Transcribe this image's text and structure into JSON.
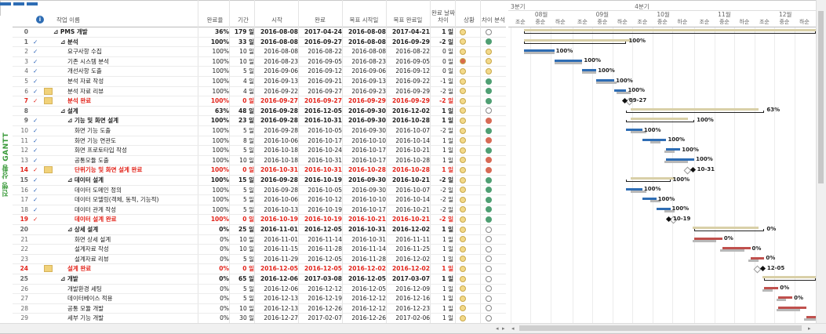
{
  "view_label": "진행 상황 GANTT",
  "columns": {
    "name": "작업 이름",
    "percent": "완료율",
    "duration": "기간",
    "start": "시작",
    "finish": "완료",
    "baseline_start": "목표 시작일",
    "baseline_finish": "목표 완료일",
    "variance": "완료 날짜 차이",
    "smile": "상황",
    "diff": "차이 분석"
  },
  "timescale": {
    "quarters": [
      "3분기",
      "4분기"
    ],
    "months": [
      "08월",
      "09월",
      "10월",
      "11월",
      "12월"
    ],
    "thirds": [
      "조순",
      "중순",
      "하순"
    ]
  },
  "colors": {
    "smile_yellow": "#f3d98a",
    "smile_red": "#d96b4c",
    "diff_green": "#4f9f73",
    "diff_red": "#d86a55",
    "bar_blue": "#2e6db4",
    "bar_red": "#c0504d",
    "baseline": "#b8b8b8",
    "summary_baseline": "#d9d0a8"
  },
  "tasks": [
    {
      "id": "0",
      "check": false,
      "note": false,
      "indent": 0,
      "name": "⊿ PMS 개발",
      "pct": "36%",
      "dur": "179 일",
      "start": "2016-08-08",
      "finish": "2017-04-24",
      "bstart": "2016-08-08",
      "bfinish": "2017-04-21",
      "var": "1 일",
      "smile": "yellow",
      "diff": "open",
      "type": "sum"
    },
    {
      "id": "1",
      "check": true,
      "note": false,
      "indent": 1,
      "name": "⊿ 분석",
      "pct": "100%",
      "dur": "33 일",
      "start": "2016-08-08",
      "finish": "2016-09-27",
      "bstart": "2016-08-08",
      "bfinish": "2016-09-29",
      "var": "-2 일",
      "smile": "yellow",
      "diff": "green",
      "type": "sum"
    },
    {
      "id": "2",
      "check": true,
      "note": false,
      "indent": 2,
      "name": "요구사항 수집",
      "pct": "100%",
      "dur": "10 일",
      "start": "2016-08-08",
      "finish": "2016-08-22",
      "bstart": "2016-08-08",
      "bfinish": "2016-08-22",
      "var": "0 일",
      "smile": "yellow",
      "diff": "yellow",
      "type": "task"
    },
    {
      "id": "3",
      "check": true,
      "note": false,
      "indent": 2,
      "name": "기존 시스템 분석",
      "pct": "100%",
      "dur": "10 일",
      "start": "2016-08-23",
      "finish": "2016-09-05",
      "bstart": "2016-08-23",
      "bfinish": "2016-09-05",
      "var": "0 일",
      "smile": "red",
      "diff": "yellow",
      "type": "task"
    },
    {
      "id": "4",
      "check": true,
      "note": false,
      "indent": 2,
      "name": "개선사항 도출",
      "pct": "100%",
      "dur": "5 일",
      "start": "2016-09-06",
      "finish": "2016-09-12",
      "bstart": "2016-09-06",
      "bfinish": "2016-09-12",
      "var": "0 일",
      "smile": "yellow",
      "diff": "yellow",
      "type": "task"
    },
    {
      "id": "5",
      "check": true,
      "note": false,
      "indent": 2,
      "name": "분석 자료 작성",
      "pct": "100%",
      "dur": "4 일",
      "start": "2016-09-13",
      "finish": "2016-09-21",
      "bstart": "2016-09-13",
      "bfinish": "2016-09-22",
      "var": "-1 일",
      "smile": "yellow",
      "diff": "green",
      "type": "task"
    },
    {
      "id": "6",
      "check": true,
      "note": true,
      "indent": 2,
      "name": "분석 자료 리뷰",
      "pct": "100%",
      "dur": "4 일",
      "start": "2016-09-22",
      "finish": "2016-09-27",
      "bstart": "2016-09-23",
      "bfinish": "2016-09-29",
      "var": "-2 일",
      "smile": "yellow",
      "diff": "green",
      "type": "task"
    },
    {
      "id": "7",
      "check": true,
      "note": true,
      "indent": 2,
      "name": "분석 완료",
      "pct": "100%",
      "dur": "0 일",
      "start": "2016-09-27",
      "finish": "2016-09-27",
      "bstart": "2016-09-29",
      "bfinish": "2016-09-29",
      "var": "-2 일",
      "smile": "yellow",
      "diff": "green",
      "type": "red"
    },
    {
      "id": "8",
      "check": false,
      "note": false,
      "indent": 1,
      "name": "⊿ 설계",
      "pct": "63%",
      "dur": "48 일",
      "start": "2016-09-28",
      "finish": "2016-12-05",
      "bstart": "2016-09-30",
      "bfinish": "2016-12-02",
      "var": "1 일",
      "smile": "yellow",
      "diff": "open",
      "type": "sum"
    },
    {
      "id": "9",
      "check": true,
      "note": false,
      "indent": 2,
      "name": "⊿ 기능 및 화면 설계",
      "pct": "100%",
      "dur": "23 일",
      "start": "2016-09-28",
      "finish": "2016-10-31",
      "bstart": "2016-09-30",
      "bfinish": "2016-10-28",
      "var": "1 일",
      "smile": "yellow",
      "diff": "red",
      "type": "sum"
    },
    {
      "id": "10",
      "check": true,
      "note": false,
      "indent": 3,
      "name": "화면 기능 도출",
      "pct": "100%",
      "dur": "5 일",
      "start": "2016-09-28",
      "finish": "2016-10-05",
      "bstart": "2016-09-30",
      "bfinish": "2016-10-07",
      "var": "-2 일",
      "smile": "yellow",
      "diff": "green",
      "type": "task"
    },
    {
      "id": "11",
      "check": true,
      "note": false,
      "indent": 3,
      "name": "화면 기능 연관도",
      "pct": "100%",
      "dur": "8 일",
      "start": "2016-10-06",
      "finish": "2016-10-17",
      "bstart": "2016-10-10",
      "bfinish": "2016-10-14",
      "var": "1 일",
      "smile": "yellow",
      "diff": "red",
      "type": "task"
    },
    {
      "id": "12",
      "check": true,
      "note": false,
      "indent": 3,
      "name": "화면 프로토타입 작성",
      "pct": "100%",
      "dur": "5 일",
      "start": "2016-10-18",
      "finish": "2016-10-24",
      "bstart": "2016-10-17",
      "bfinish": "2016-10-21",
      "var": "1 일",
      "smile": "yellow",
      "diff": "green",
      "type": "task"
    },
    {
      "id": "13",
      "check": true,
      "note": false,
      "indent": 3,
      "name": "공통모듈 도출",
      "pct": "100%",
      "dur": "10 일",
      "start": "2016-10-18",
      "finish": "2016-10-31",
      "bstart": "2016-10-17",
      "bfinish": "2016-10-28",
      "var": "1 일",
      "smile": "yellow",
      "diff": "red",
      "type": "task"
    },
    {
      "id": "14",
      "check": true,
      "note": true,
      "indent": 3,
      "name": "단위기능 및 화면 설계 완료",
      "pct": "100%",
      "dur": "0 일",
      "start": "2016-10-31",
      "finish": "2016-10-31",
      "bstart": "2016-10-28",
      "bfinish": "2016-10-28",
      "var": "1 일",
      "smile": "yellow",
      "diff": "red",
      "type": "red"
    },
    {
      "id": "15",
      "check": true,
      "note": false,
      "indent": 2,
      "name": "⊿ 데이터 설계",
      "pct": "100%",
      "dur": "15 일",
      "start": "2016-09-28",
      "finish": "2016-10-19",
      "bstart": "2016-09-30",
      "bfinish": "2016-10-21",
      "var": "-2 일",
      "smile": "yellow",
      "diff": "green",
      "type": "sum"
    },
    {
      "id": "16",
      "check": true,
      "note": false,
      "indent": 3,
      "name": "데이터 도메인 정의",
      "pct": "100%",
      "dur": "5 일",
      "start": "2016-09-28",
      "finish": "2016-10-05",
      "bstart": "2016-09-30",
      "bfinish": "2016-10-07",
      "var": "-2 일",
      "smile": "yellow",
      "diff": "green",
      "type": "task"
    },
    {
      "id": "17",
      "check": true,
      "note": false,
      "indent": 3,
      "name": "데이터 모델링(객체, 동적, 기능적)",
      "pct": "100%",
      "dur": "5 일",
      "start": "2016-10-06",
      "finish": "2016-10-12",
      "bstart": "2016-10-10",
      "bfinish": "2016-10-14",
      "var": "-2 일",
      "smile": "yellow",
      "diff": "green",
      "type": "task"
    },
    {
      "id": "18",
      "check": true,
      "note": false,
      "indent": 3,
      "name": "데이터 관계 작성",
      "pct": "100%",
      "dur": "5 일",
      "start": "2016-10-13",
      "finish": "2016-10-19",
      "bstart": "2016-10-17",
      "bfinish": "2016-10-21",
      "var": "-2 일",
      "smile": "yellow",
      "diff": "green",
      "type": "task"
    },
    {
      "id": "19",
      "check": true,
      "note": false,
      "indent": 3,
      "name": "데이터 설계 완료",
      "pct": "100%",
      "dur": "0 일",
      "start": "2016-10-19",
      "finish": "2016-10-19",
      "bstart": "2016-10-21",
      "bfinish": "2016-10-21",
      "var": "-2 일",
      "smile": "yellow",
      "diff": "green",
      "type": "red"
    },
    {
      "id": "20",
      "check": false,
      "note": false,
      "indent": 2,
      "name": "⊿ 상세 설계",
      "pct": "0%",
      "dur": "25 일",
      "start": "2016-11-01",
      "finish": "2016-12-05",
      "bstart": "2016-10-31",
      "bfinish": "2016-12-02",
      "var": "1 일",
      "smile": "yellow",
      "diff": "open",
      "type": "sum"
    },
    {
      "id": "21",
      "check": false,
      "note": false,
      "indent": 3,
      "name": "화면 상세 설계",
      "pct": "0%",
      "dur": "10 일",
      "start": "2016-11-01",
      "finish": "2016-11-14",
      "bstart": "2016-10-31",
      "bfinish": "2016-11-11",
      "var": "1 일",
      "smile": "yellow",
      "diff": "open",
      "type": "task"
    },
    {
      "id": "22",
      "check": false,
      "note": false,
      "indent": 3,
      "name": "설계자료 작성",
      "pct": "0%",
      "dur": "10 일",
      "start": "2016-11-15",
      "finish": "2016-11-28",
      "bstart": "2016-11-14",
      "bfinish": "2016-11-25",
      "var": "1 일",
      "smile": "yellow",
      "diff": "open",
      "type": "task"
    },
    {
      "id": "23",
      "check": false,
      "note": false,
      "indent": 3,
      "name": "설계자료 리뷰",
      "pct": "0%",
      "dur": "5 일",
      "start": "2016-11-29",
      "finish": "2016-12-05",
      "bstart": "2016-11-28",
      "bfinish": "2016-12-02",
      "var": "1 일",
      "smile": "yellow",
      "diff": "open",
      "type": "task"
    },
    {
      "id": "24",
      "check": false,
      "note": true,
      "indent": 2,
      "name": "설계 완료",
      "pct": "0%",
      "dur": "0 일",
      "start": "2016-12-05",
      "finish": "2016-12-05",
      "bstart": "2016-12-02",
      "bfinish": "2016-12-02",
      "var": "1 일",
      "smile": "yellow",
      "diff": "open",
      "type": "red"
    },
    {
      "id": "25",
      "check": false,
      "note": false,
      "indent": 1,
      "name": "⊿ 개발",
      "pct": "0%",
      "dur": "65 일",
      "start": "2016-12-06",
      "finish": "2017-03-08",
      "bstart": "2016-12-05",
      "bfinish": "2017-03-07",
      "var": "1 일",
      "smile": "yellow",
      "diff": "open",
      "type": "sum"
    },
    {
      "id": "26",
      "check": false,
      "note": false,
      "indent": 2,
      "name": "개발환경 세팅",
      "pct": "0%",
      "dur": "5 일",
      "start": "2016-12-06",
      "finish": "2016-12-12",
      "bstart": "2016-12-05",
      "bfinish": "2016-12-09",
      "var": "1 일",
      "smile": "yellow",
      "diff": "open",
      "type": "task"
    },
    {
      "id": "27",
      "check": false,
      "note": false,
      "indent": 2,
      "name": "데이터베이스 적용",
      "pct": "0%",
      "dur": "5 일",
      "start": "2016-12-13",
      "finish": "2016-12-19",
      "bstart": "2016-12-12",
      "bfinish": "2016-12-16",
      "var": "1 일",
      "smile": "yellow",
      "diff": "open",
      "type": "task"
    },
    {
      "id": "28",
      "check": false,
      "note": false,
      "indent": 2,
      "name": "공통 모듈 개발",
      "pct": "0%",
      "dur": "10 일",
      "start": "2016-12-13",
      "finish": "2016-12-26",
      "bstart": "2016-12-12",
      "bfinish": "2016-12-23",
      "var": "1 일",
      "smile": "yellow",
      "diff": "open",
      "type": "task"
    },
    {
      "id": "29",
      "check": false,
      "note": false,
      "indent": 2,
      "name": "세부 기능 개발",
      "pct": "0%",
      "dur": "30 일",
      "start": "2016-12-27",
      "finish": "2017-02-07",
      "bstart": "2016-12-26",
      "bfinish": "2017-02-06",
      "var": "1 일",
      "smile": "yellow",
      "diff": "open",
      "type": "task"
    }
  ],
  "gantt_labels": [
    {
      "row": 0,
      "text": "100%"
    },
    {
      "row": 1,
      "text": "100%"
    },
    {
      "row": 2,
      "text": "100%"
    },
    {
      "row": 3,
      "text": "100%"
    },
    {
      "row": 4,
      "text": "100%"
    },
    {
      "row": 5,
      "text": "100%"
    },
    {
      "row": 6,
      "text": "100%"
    },
    {
      "row": 7,
      "text": "09-27"
    },
    {
      "row": 8,
      "text": "63%"
    },
    {
      "row": 9,
      "text": "100%"
    },
    {
      "row": 10,
      "text": "100%"
    },
    {
      "row": 11,
      "text": "100%"
    },
    {
      "row": 12,
      "text": "100%"
    },
    {
      "row": 13,
      "text": "100%"
    },
    {
      "row": 14,
      "text": "10-31"
    },
    {
      "row": 15,
      "text": "100%"
    },
    {
      "row": 16,
      "text": "100%"
    },
    {
      "row": 17,
      "text": "100%"
    },
    {
      "row": 18,
      "text": "100%"
    },
    {
      "row": 19,
      "text": "10-19"
    },
    {
      "row": 20,
      "text": "0%"
    },
    {
      "row": 21,
      "text": "0%"
    },
    {
      "row": 22,
      "text": "0%"
    },
    {
      "row": 23,
      "text": "0%"
    },
    {
      "row": 24,
      "text": "12-05"
    },
    {
      "row": 26,
      "text": "0%"
    },
    {
      "row": 27,
      "text": "0%"
    }
  ]
}
